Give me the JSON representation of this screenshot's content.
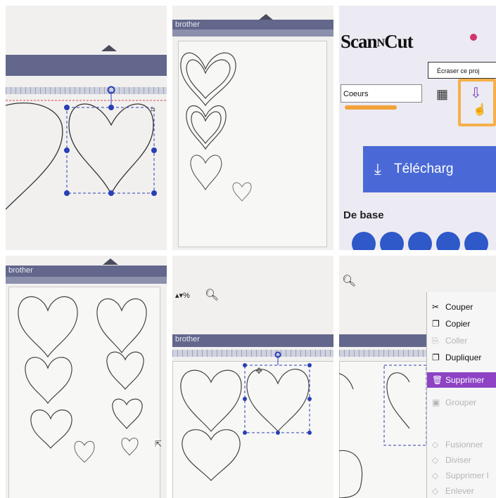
{
  "panel2": {
    "brand": "brother"
  },
  "panel3": {
    "logo_text": "ScanNCut",
    "tooltip": "Écraser ce proj",
    "project_name_value": "Coeurs",
    "download_label": "Télécharg",
    "section_label": "De base",
    "accent_color": "#f5b04a"
  },
  "panel4": {
    "brand": "brother"
  },
  "panel5": {
    "brand": "brother",
    "zoom_suffix": "%",
    "search_icon": "search-icon"
  },
  "panel6": {
    "search_icon": "search-icon",
    "menu": [
      {
        "label": "Couper",
        "icon": "scissors-icon",
        "state": "enabled"
      },
      {
        "label": "Copier",
        "icon": "copy-icon",
        "state": "enabled"
      },
      {
        "label": "Coller",
        "icon": "paste-icon",
        "state": "disabled"
      },
      {
        "label": "Dupliquer",
        "icon": "duplicate-icon",
        "state": "enabled"
      },
      {
        "label": "Supprimer",
        "icon": "trash-icon",
        "state": "selected"
      },
      {
        "label": "Grouper",
        "icon": "group-icon",
        "state": "disabled"
      },
      {
        "label": "Fusionner",
        "icon": "merge-icon",
        "state": "disabled"
      },
      {
        "label": "Diviser",
        "icon": "split-icon",
        "state": "disabled"
      },
      {
        "label": "Supprimer l",
        "icon": "remove-icon",
        "state": "disabled"
      },
      {
        "label": "Enlever",
        "icon": "erase-icon",
        "state": "disabled"
      }
    ],
    "selected_color": "#8d43c4"
  }
}
